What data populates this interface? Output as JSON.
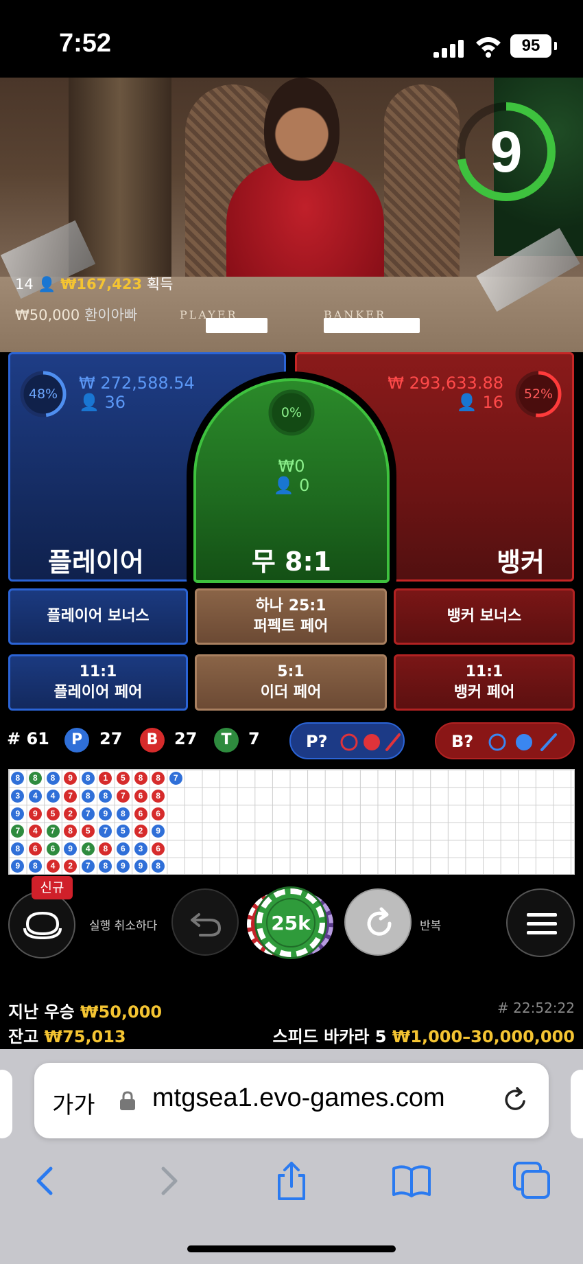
{
  "status_bar": {
    "time": "7:52",
    "battery": "95"
  },
  "video": {
    "countdown": "9",
    "winners_count": "14",
    "winners_amount": "₩167,423",
    "winners_suffix": "획득",
    "last_win_amount": "₩50,000",
    "last_win_user": "환이아빠",
    "table_player_label": "PLAYER",
    "table_banker_label": "BANKER"
  },
  "bets": {
    "player": {
      "pct": "48%",
      "amount": "₩ 272,588.54",
      "players": "36",
      "label": "플레이어",
      "pct_value": 0.48
    },
    "tie": {
      "pct": "0%",
      "amount": "₩0",
      "players": "0",
      "label": "무 8:1"
    },
    "banker": {
      "pct": "52%",
      "amount": "₩ 293,633.88",
      "players": "16",
      "label": "뱅커",
      "pct_value": 0.52
    }
  },
  "side_bets": {
    "player_bonus": "플레이어 보너스",
    "perfect_pair_l1": "하나 25:1",
    "perfect_pair_l2": "퍼펙트 페어",
    "banker_bonus": "뱅커 보너스",
    "player_pair_l1": "11:1",
    "player_pair_l2": "플레이어 페어",
    "either_pair_l1": "5:1",
    "either_pair_l2": "이더 페어",
    "banker_pair_l1": "11:1",
    "banker_pair_l2": "뱅커 페어"
  },
  "summary": {
    "round_label": "# 61",
    "p_letter": "P",
    "p_count": "27",
    "b_letter": "B",
    "b_count": "27",
    "t_letter": "T",
    "t_count": "7",
    "player_predict": "P?",
    "banker_predict": "B?"
  },
  "roadmap": {
    "columns": [
      [
        [
          "8",
          "blue"
        ],
        [
          "3",
          "blue"
        ],
        [
          "9",
          "blue"
        ],
        [
          "7",
          "green"
        ],
        [
          "8",
          "blue"
        ],
        [
          "9",
          "blue"
        ]
      ],
      [
        [
          "8",
          "green"
        ],
        [
          "4",
          "blue"
        ],
        [
          "9",
          "red"
        ],
        [
          "4",
          "red"
        ],
        [
          "6",
          "red"
        ],
        [
          "8",
          "blue"
        ]
      ],
      [
        [
          "8",
          "blue"
        ],
        [
          "4",
          "blue"
        ],
        [
          "5",
          "red"
        ],
        [
          "7",
          "green"
        ],
        [
          "6",
          "green"
        ],
        [
          "4",
          "red"
        ]
      ],
      [
        [
          "9",
          "red"
        ],
        [
          "7",
          "red"
        ],
        [
          "2",
          "red"
        ],
        [
          "8",
          "red"
        ],
        [
          "9",
          "blue"
        ],
        [
          "2",
          "red"
        ]
      ],
      [
        [
          "8",
          "blue"
        ],
        [
          "8",
          "blue"
        ],
        [
          "7",
          "blue"
        ],
        [
          "5",
          "red"
        ],
        [
          "4",
          "green"
        ],
        [
          "7",
          "blue"
        ]
      ],
      [
        [
          "1",
          "red"
        ],
        [
          "8",
          "blue"
        ],
        [
          "9",
          "blue"
        ],
        [
          "7",
          "blue"
        ],
        [
          "8",
          "red"
        ],
        [
          "8",
          "blue"
        ]
      ],
      [
        [
          "5",
          "red"
        ],
        [
          "7",
          "red"
        ],
        [
          "8",
          "blue"
        ],
        [
          "5",
          "blue"
        ],
        [
          "6",
          "blue"
        ],
        [
          "9",
          "blue"
        ]
      ],
      [
        [
          "8",
          "red"
        ],
        [
          "6",
          "red"
        ],
        [
          "6",
          "red"
        ],
        [
          "2",
          "red"
        ],
        [
          "3",
          "blue"
        ],
        [
          "9",
          "blue"
        ]
      ],
      [
        [
          "8",
          "red"
        ],
        [
          "8",
          "red"
        ],
        [
          "6",
          "red"
        ],
        [
          "9",
          "blue"
        ],
        [
          "6",
          "red"
        ],
        [
          "8",
          "blue"
        ]
      ],
      [
        [
          "7",
          "blue"
        ]
      ]
    ]
  },
  "controls": {
    "new_badge": "신규",
    "undo_label": "실행 취소하다",
    "chip_value": "25k",
    "repeat_label": "반복"
  },
  "footer": {
    "last_win_label": "지난 우승",
    "last_win_value": "₩50,000",
    "balance_label": "잔고",
    "balance_value": "₩75,013",
    "round_id": "# 22:52:22",
    "table_name": "스피드 바카라 5",
    "limits": "₩1,000–30,000,000"
  },
  "browser": {
    "aa_label": "가가",
    "url": "mtgsea1.evo-games.com"
  },
  "colors": {
    "blue": "#2f6fd8",
    "red": "#d62b2b",
    "green": "#2e8b3e",
    "gold": "#f4c432"
  }
}
